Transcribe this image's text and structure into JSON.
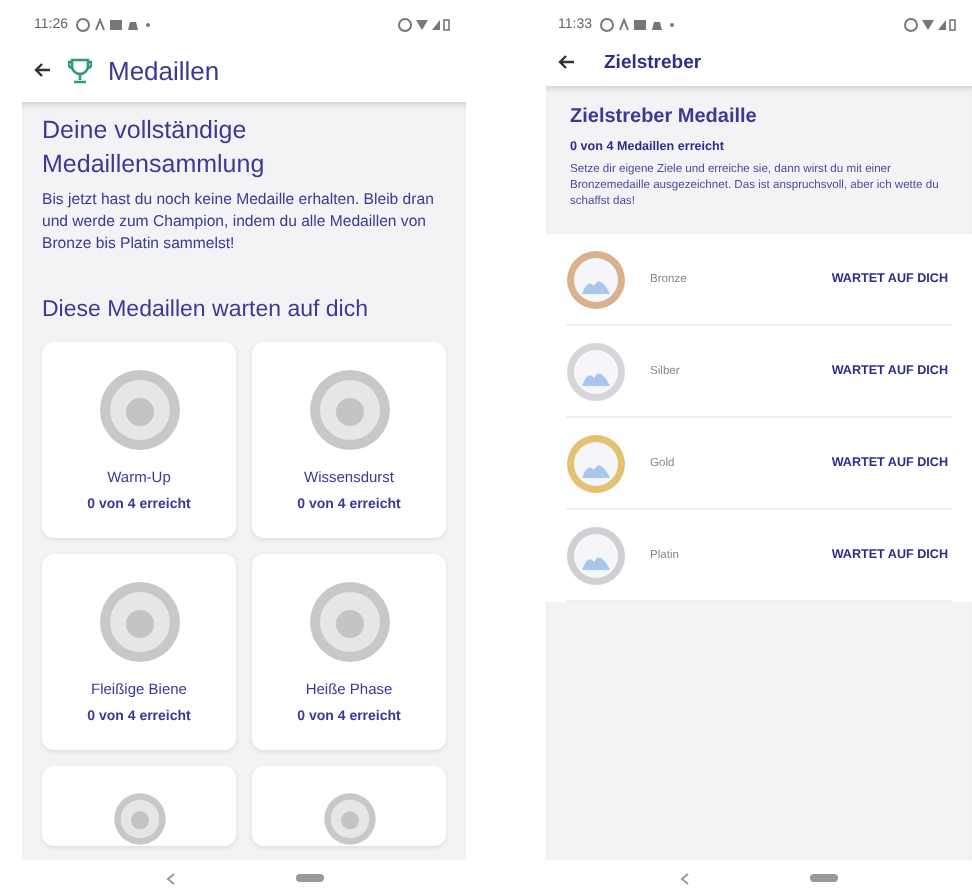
{
  "left_screen": {
    "status_bar": {
      "time": "11:26"
    },
    "header": {
      "title": "Medaillen"
    },
    "intro": {
      "title": "Deine vollständige Medaillensammlung",
      "text": "Bis jetzt hast du noch keine Medaille erhalten. Bleib dran und werde zum Champion, indem du alle Medaillen von Bronze bis Platin sammelst!"
    },
    "section_title": "Diese Medaillen warten auf dich",
    "cards": [
      {
        "kind": "full",
        "name": "Warm-Up",
        "progress": "0 von 4 erreicht"
      },
      {
        "kind": "full",
        "name": "Wissensdurst",
        "progress": "0 von 4 erreicht"
      },
      {
        "kind": "full",
        "name": "Fleißige Biene",
        "progress": "0 von 4 erreicht"
      },
      {
        "kind": "full",
        "name": "Heiße Phase",
        "progress": "0 von 4 erreicht"
      },
      {
        "kind": "cut"
      },
      {
        "kind": "cut"
      }
    ]
  },
  "right_screen": {
    "status_bar": {
      "time": "11:33"
    },
    "header": {
      "title": "Zielstreber"
    },
    "summary": {
      "title": "Zielstreber Medaille",
      "progress": "0 von 4 Medaillen erreicht",
      "text": "Setze dir eigene Ziele und erreiche sie, dann wirst du mit einer Bronzemedaille ausgezeichnet. Das ist anspruchsvoll, aber ich wette du schaffst das!"
    },
    "levels": [
      {
        "name": "Bronze",
        "status": "WARTET AUF DICH",
        "color": "#d9b18e"
      },
      {
        "name": "Silber",
        "status": "WARTET AUF DICH",
        "color": "#d6d6da"
      },
      {
        "name": "Gold",
        "status": "WARTET AUF DICH",
        "color": "#e3c173"
      },
      {
        "name": "Platin",
        "status": "WARTET AUF DICH",
        "color": "#cfcfd4"
      }
    ]
  }
}
